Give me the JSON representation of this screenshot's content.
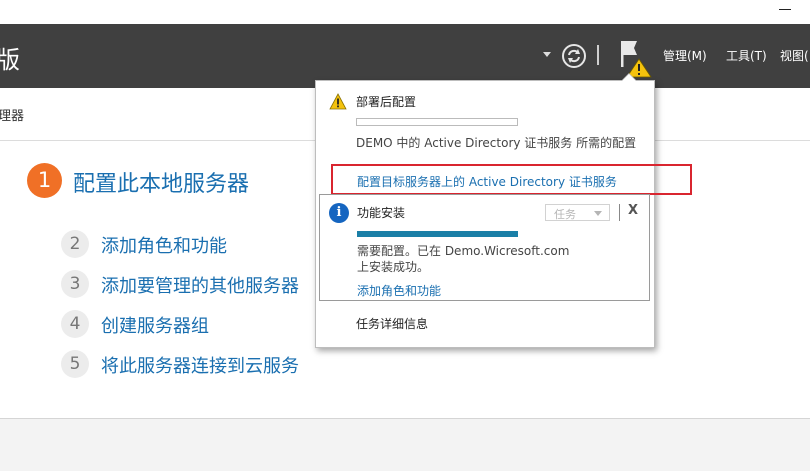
{
  "header": {
    "title": "版",
    "menu": [
      {
        "label": "管理(M)"
      },
      {
        "label": "工具(T)"
      },
      {
        "label": "视图("
      }
    ]
  },
  "breadcrumb": {
    "text": "理器"
  },
  "quickstart": {
    "step1": {
      "number": "1",
      "label": "配置此本地服务器"
    },
    "steps": [
      {
        "number": "2",
        "label": "添加角色和功能"
      },
      {
        "number": "3",
        "label": "添加要管理的其他服务器"
      },
      {
        "number": "4",
        "label": "创建服务器组"
      },
      {
        "number": "5",
        "label": "将此服务器连接到云服务"
      }
    ]
  },
  "popup": {
    "notification1": {
      "title": "部署后配置",
      "description": "DEMO 中的 Active Directory 证书服务 所需的配置",
      "link": "配置目标服务器上的 Active Directory 证书服务"
    },
    "notification2": {
      "title": "功能安装",
      "task_dropdown": "任务",
      "close": "X",
      "progress_fraction": 1.0,
      "description": "需要配置。已在 Demo.Wicresoft.com 上安装成功。",
      "link": "添加角色和功能"
    },
    "task_details": "任务详细信息"
  },
  "colors": {
    "header_bg": "#404040",
    "accent_orange": "#f07026",
    "link_blue": "#1a6fb0",
    "highlight_red": "#d9252f",
    "progress_teal": "#1a7fa7"
  },
  "icons": {
    "refresh": "refresh-icon",
    "flag": "notification-flag-icon",
    "warning": "warning-icon",
    "info": "info-icon"
  }
}
